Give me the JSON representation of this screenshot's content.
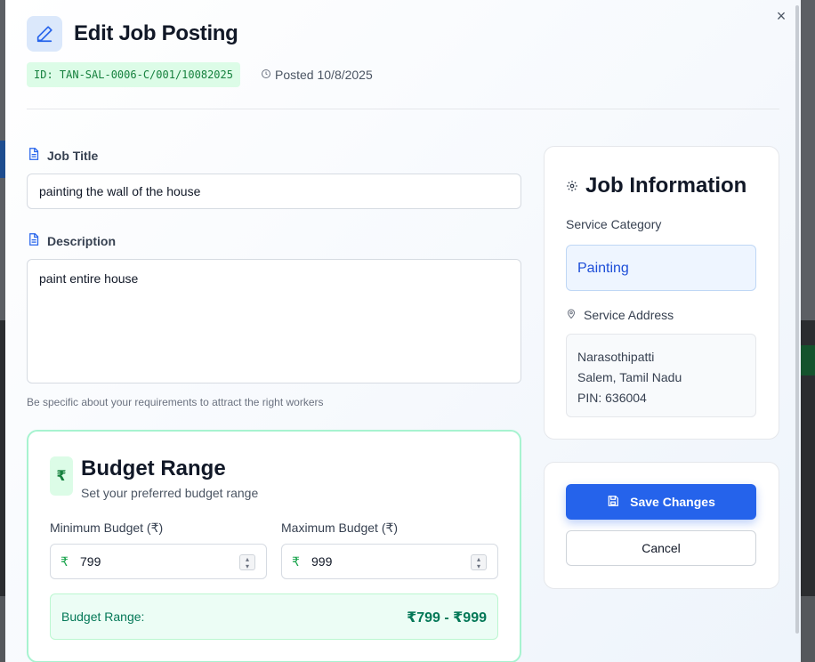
{
  "modal": {
    "title": "Edit Job Posting",
    "close_label": "×",
    "job_id": "ID: TAN-SAL-0006-C/001/10082025",
    "posted": "Posted 10/8/2025"
  },
  "form": {
    "title_label": "Job Title",
    "title_value": "painting the wall of the house",
    "description_label": "Description",
    "description_value": "paint entire house",
    "description_hint": "Be specific about your requirements to attract the right workers"
  },
  "budget": {
    "currency_symbol": "₹",
    "title": "Budget Range",
    "subtitle": "Set your preferred budget range",
    "min_label": "Minimum Budget (₹)",
    "min_value": "799",
    "max_label": "Maximum Budget (₹)",
    "max_value": "999",
    "range_label": "Budget Range:",
    "range_value": "₹799 - ₹999"
  },
  "job_info": {
    "title": "Job Information",
    "category_label": "Service Category",
    "category_value": "Painting",
    "address_label": "Service Address",
    "address_line1": "Narasothipatti",
    "address_line2": "Salem, Tamil Nadu",
    "address_line3": "PIN: 636004"
  },
  "actions": {
    "save_label": "Save Changes",
    "cancel_label": "Cancel"
  },
  "colors": {
    "accent": "#2563eb",
    "success": "#15803d",
    "success_bg": "#dcfce7"
  }
}
